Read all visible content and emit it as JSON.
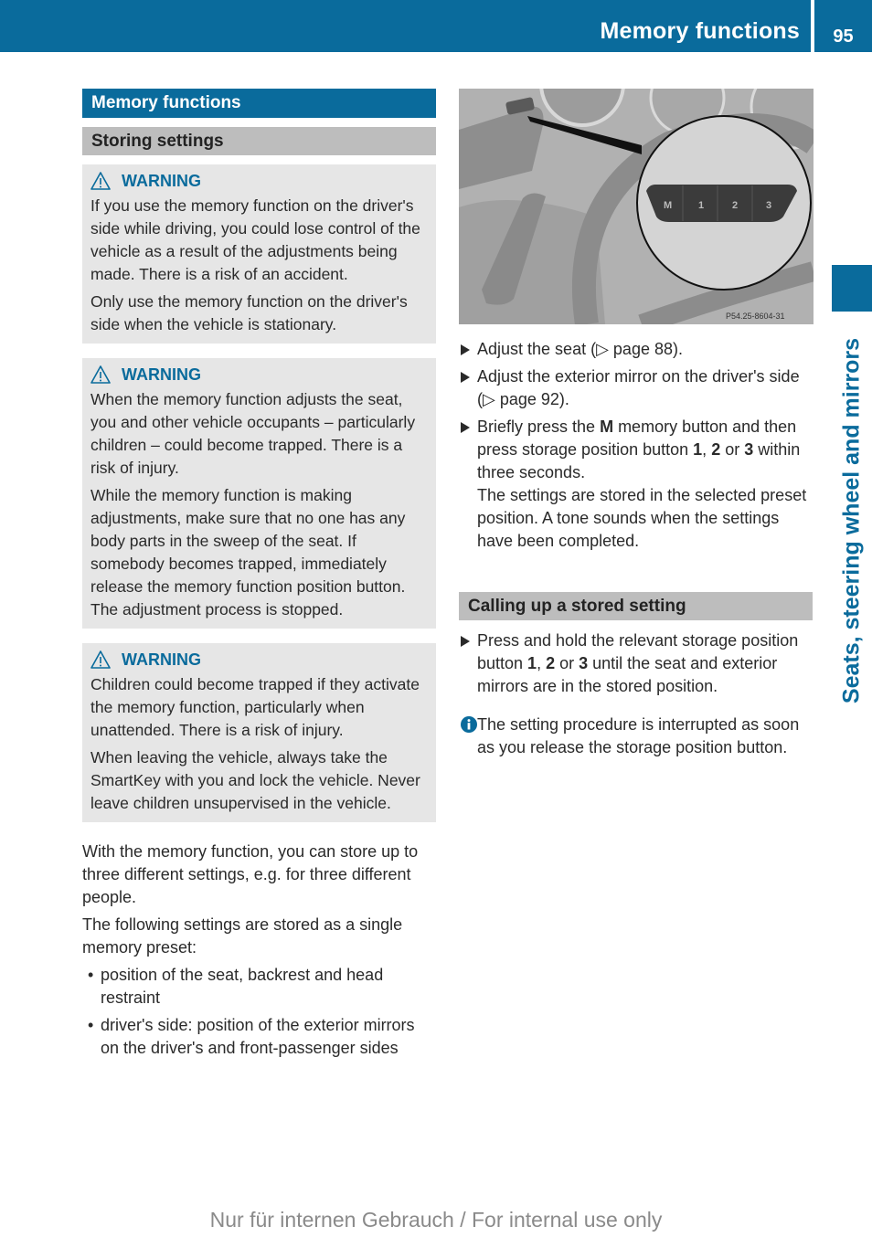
{
  "header": {
    "title": "Memory functions",
    "page_number": "95"
  },
  "side_tab": {
    "label": "Seats, steering wheel and mirrors"
  },
  "colors": {
    "brand_blue": "#0a6b9c",
    "section_gray": "#bdbdbd",
    "warning_box_bg": "#e6e6e6"
  },
  "left": {
    "section_title": "Memory functions",
    "subsection_title": "Storing settings",
    "warnings": [
      {
        "label": "WARNING",
        "icon": "warning-triangle-icon",
        "paragraphs": [
          "If you use the memory function on the driver's side while driving, you could lose control of the vehicle as a result of the adjustments being made. There is a risk of an accident.",
          "Only use the memory function on the driver's side when the vehicle is stationary."
        ]
      },
      {
        "label": "WARNING",
        "icon": "warning-triangle-icon",
        "paragraphs": [
          "When the memory function adjusts the seat, you and other vehicle occupants – particularly children – could become trapped. There is a risk of injury.",
          "While the memory function is making adjustments, make sure that no one has any body parts in the sweep of the seat. If somebody becomes trapped, immediately release the memory function position button. The adjustment process is stopped."
        ]
      },
      {
        "label": "WARNING",
        "icon": "warning-triangle-icon",
        "paragraphs": [
          "Children could become trapped if they activate the memory function, particularly when unattended. There is a risk of injury.",
          "When leaving the vehicle, always take the SmartKey with you and lock the vehicle. Never leave children unsupervised in the vehicle."
        ]
      }
    ],
    "intro": [
      "With the memory function, you can store up to three different settings, e.g. for three different people.",
      "The following settings are stored as a single memory preset:"
    ],
    "bullets": [
      "position of the seat, backrest and head restraint",
      "driver's side: position of the exterior mirrors on the driver's and front-passenger sides"
    ]
  },
  "figure": {
    "buttons": [
      "M",
      "1",
      "2",
      "3"
    ],
    "code": "P54.25-8604-31"
  },
  "right": {
    "steps": [
      {
        "pre": "Adjust the seat (",
        "ref": "▷ page 88",
        "post": ")."
      },
      {
        "pre": "Adjust the exterior mirror on the driver's side (",
        "ref": "▷ page 92",
        "post": ")."
      }
    ],
    "step3": {
      "t1": "Briefly press the ",
      "b1": "M",
      "t2": " memory button and then press storage position button ",
      "b2": "1",
      "t3": ", ",
      "b3": "2",
      "t4": " or ",
      "b4": "3",
      "t5": " within three seconds.",
      "result": "The settings are stored in the selected preset position. A tone sounds when the settings have been completed."
    },
    "subsection_title": "Calling up a stored setting",
    "step4": {
      "t1": "Press and hold the relevant storage position button ",
      "b1": "1",
      "t2": ", ",
      "b2": "2",
      "t3": " or ",
      "b3": "3",
      "t4": " until the seat and exterior mirrors are in the stored position."
    },
    "note": "The setting procedure is interrupted as soon as you release the storage position button."
  },
  "footer": {
    "watermark": "Nur für internen Gebrauch / For internal use only"
  }
}
